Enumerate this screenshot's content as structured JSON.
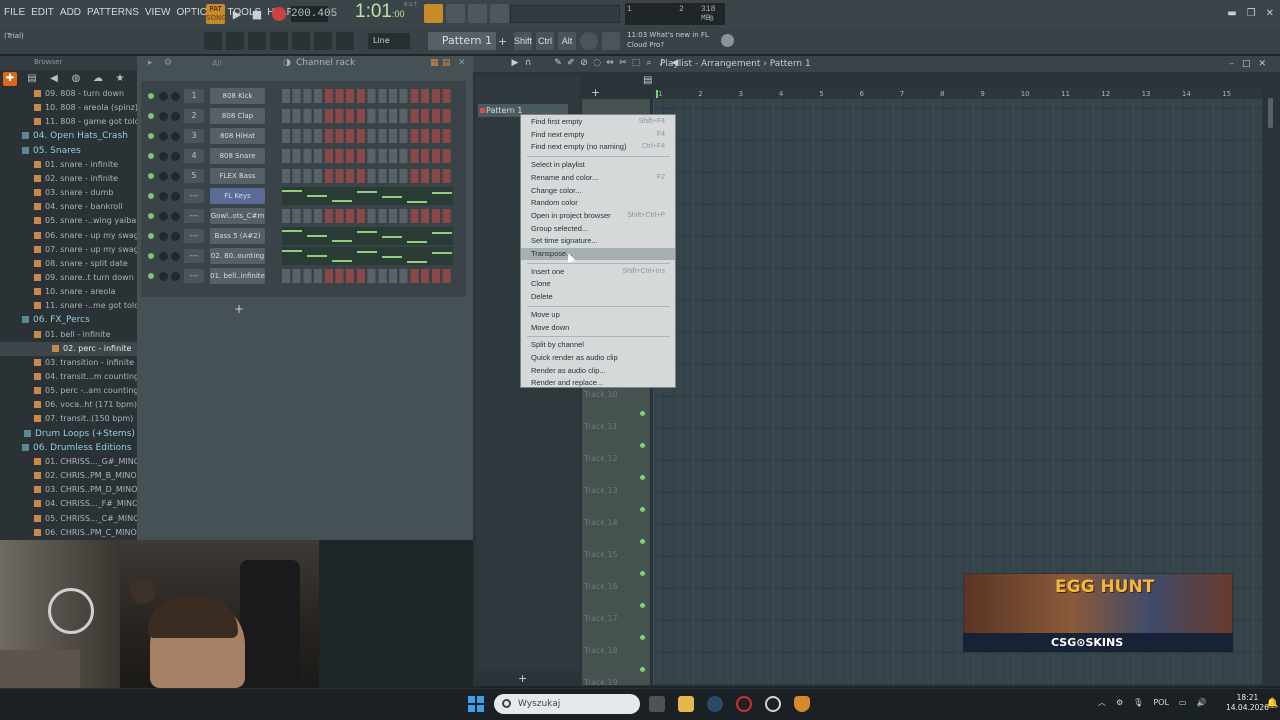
{
  "menu": [
    "FILE",
    "EDIT",
    "ADD",
    "PATTERNS",
    "VIEW",
    "OPTIONS",
    "TOOLS",
    "HELP"
  ],
  "transport": {
    "pat_label": "PAT",
    "song_label": "SONG",
    "tempo": "200.405",
    "time_main": "1:01",
    "time_sub": ":00",
    "time_top": "B:S:T"
  },
  "cpu": {
    "a": "1",
    "b": "2",
    "mem": "318 MB",
    "c": "0"
  },
  "hint": "(Trial)",
  "snap": "Line",
  "pattern_selector": "Pattern 1",
  "modifiers": [
    "Shift",
    "Ctrl",
    "Alt"
  ],
  "news": {
    "time": "11:03",
    "line1": "What's new in FL",
    "line2": "Cloud Pro?"
  },
  "browser": {
    "title": "Browser",
    "items": [
      {
        "label": "09. 808 - turn down",
        "type": "file"
      },
      {
        "label": "10. 808 - areola (spinz)",
        "type": "file"
      },
      {
        "label": "11. 808 - game got told",
        "type": "file"
      },
      {
        "label": "04. Open Hats_Crash",
        "type": "folder"
      },
      {
        "label": "05. Snares",
        "type": "folder"
      },
      {
        "label": "01. snare - infinite",
        "type": "file"
      },
      {
        "label": "02. snare - infinite",
        "type": "file"
      },
      {
        "label": "03. snare - dumb",
        "type": "file"
      },
      {
        "label": "04. snare - bankroll",
        "type": "file"
      },
      {
        "label": "05. snare -..wing yaiba",
        "type": "file"
      },
      {
        "label": "06. snare - up my swag",
        "type": "file"
      },
      {
        "label": "07. snare - up my swag",
        "type": "file"
      },
      {
        "label": "08. snare - split date",
        "type": "file"
      },
      {
        "label": "09. snare..t turn down",
        "type": "file"
      },
      {
        "label": "10. snare - areola",
        "type": "file"
      },
      {
        "label": "11. snare -..me got told",
        "type": "file"
      },
      {
        "label": "06. FX_Percs",
        "type": "folder"
      },
      {
        "label": "01. bell - infinite",
        "type": "file"
      },
      {
        "label": "02. perc - infinite",
        "type": "file",
        "selected": true
      },
      {
        "label": "03. transition - infinite",
        "type": "file"
      },
      {
        "label": "04. transit...m counting",
        "type": "file"
      },
      {
        "label": "05. perc -..am counting",
        "type": "file"
      },
      {
        "label": "06. voca..ht (171 bpm)",
        "type": "file"
      },
      {
        "label": "07. transit..(150 bpm)",
        "type": "file"
      },
      {
        "label": "Drum Loops (+Stems)",
        "type": "folder"
      },
      {
        "label": "06. Drumless Editions",
        "type": "folder"
      },
      {
        "label": "01. CHRISS..._G#_MINOR",
        "type": "file"
      },
      {
        "label": "02. CHRIS..PM_B_MINOR",
        "type": "file"
      },
      {
        "label": "03. CHRIS..PM_D_MINOR",
        "type": "file"
      },
      {
        "label": "04. CHRISS..._F#_MINOR",
        "type": "file"
      },
      {
        "label": "05. CHRISS..._C#_MINOR",
        "type": "file"
      },
      {
        "label": "06. CHRIS..PM_C_MINOR",
        "type": "file"
      }
    ]
  },
  "channel_rack": {
    "title": "Channel rack",
    "filter": "All",
    "channels": [
      {
        "num": "1",
        "name": "808 Kick",
        "kind": "steps"
      },
      {
        "num": "2",
        "name": "808 Clap",
        "kind": "steps"
      },
      {
        "num": "3",
        "name": "808 HiHat",
        "kind": "steps"
      },
      {
        "num": "4",
        "name": "808 Snare",
        "kind": "steps"
      },
      {
        "num": "5",
        "name": "FLEX Bass",
        "kind": "steps"
      },
      {
        "num": "---",
        "name": "FL Keys",
        "kind": "roll"
      },
      {
        "num": "---",
        "name": "Gowl..ots_C#m",
        "kind": "steps"
      },
      {
        "num": "---",
        "name": "Bass 5 (A#2)",
        "kind": "roll"
      },
      {
        "num": "---",
        "name": "02. 80..ounting",
        "kind": "roll"
      },
      {
        "num": "---",
        "name": "01. bell..infinite",
        "kind": "steps"
      }
    ]
  },
  "playlist": {
    "title": "Playlist - Arrangement",
    "pattern": "Pattern 1",
    "pattern_clip": "Pattern 1",
    "ruler": [
      "1",
      "2",
      "3",
      "4",
      "5",
      "6",
      "7",
      "8",
      "9",
      "10",
      "11",
      "12",
      "13",
      "14",
      "15"
    ],
    "tracks": [
      "Track 10",
      "Track 11",
      "Track 12",
      "Track 13",
      "Track 14",
      "Track 15",
      "Track 16",
      "Track 17",
      "Track 18",
      "Track 19"
    ]
  },
  "context_menu": [
    {
      "label": "Find first empty",
      "shortcut": "Shift+F4"
    },
    {
      "label": "Find next empty",
      "shortcut": "F4"
    },
    {
      "label": "Find next empty (no naming)",
      "shortcut": "Ctrl+F4"
    },
    {
      "sep": true
    },
    {
      "label": "Select in playlist",
      "shortcut": ""
    },
    {
      "label": "Rename and color...",
      "shortcut": "F2"
    },
    {
      "label": "Change color...",
      "shortcut": ""
    },
    {
      "label": "Random color",
      "shortcut": ""
    },
    {
      "label": "Open in project browser",
      "shortcut": "Shift+Ctrl+P"
    },
    {
      "label": "Group selected...",
      "shortcut": ""
    },
    {
      "label": "Set time signature...",
      "shortcut": ""
    },
    {
      "label": "Transpose...",
      "shortcut": "",
      "highlight": true
    },
    {
      "sep": true
    },
    {
      "label": "Insert one",
      "shortcut": "Shift+Ctrl+Ins"
    },
    {
      "label": "Clone",
      "shortcut": ""
    },
    {
      "label": "Delete",
      "shortcut": ""
    },
    {
      "sep": true
    },
    {
      "label": "Move up",
      "shortcut": ""
    },
    {
      "label": "Move down",
      "shortcut": ""
    },
    {
      "sep": true
    },
    {
      "label": "Split by channel",
      "shortcut": ""
    },
    {
      "label": "Quick render as audio clip",
      "shortcut": ""
    },
    {
      "label": "Render as audio clip...",
      "shortcut": ""
    },
    {
      "label": "Render and replace...",
      "shortcut": ""
    }
  ],
  "ad": {
    "title": "EGG HUNT",
    "brand": "CSG⊙SKINS"
  },
  "taskbar": {
    "search_placeholder": "Wyszukaj",
    "lang": "POL",
    "time": "18:21",
    "date": "14.04.2026"
  },
  "colors": {
    "accent": "#c98a2a",
    "record": "#d14040",
    "led": "#7ed46c"
  }
}
